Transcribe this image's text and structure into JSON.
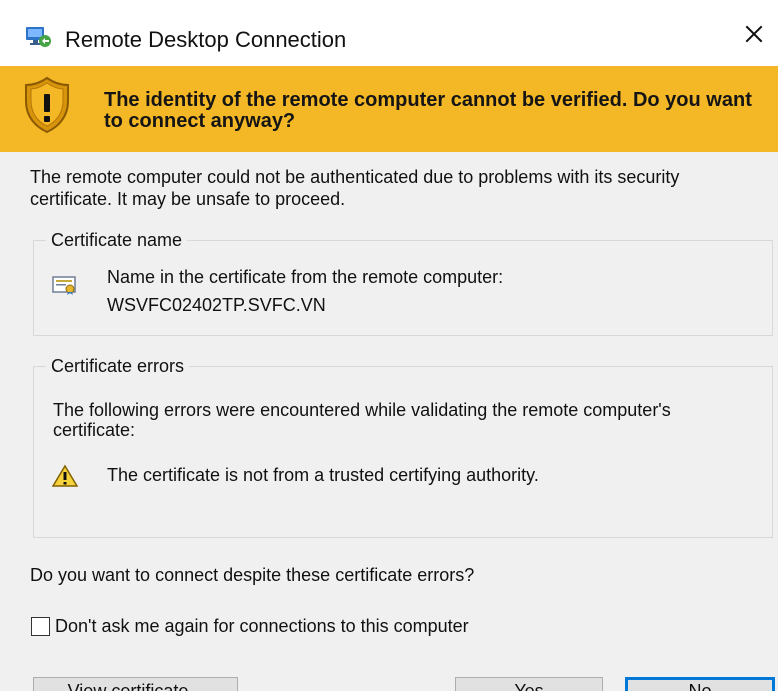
{
  "window": {
    "title": "Remote Desktop Connection",
    "close_icon": "close-icon",
    "app_icon": "remote-desktop-icon"
  },
  "warning_banner": {
    "text": "The identity of the remote computer cannot be verified. Do you want to connect anyway?",
    "icon": "security-warning-shield-icon",
    "background": "#f4b725"
  },
  "intro": {
    "text": "The remote computer could not be authenticated due to problems with its security certificate. It may be unsafe to proceed."
  },
  "certificate_name": {
    "group_title": "Certificate name",
    "icon": "certificate-icon",
    "label": "Name in the certificate from the remote computer:",
    "value": "WSVFC02402TP.SVFC.VN"
  },
  "certificate_errors": {
    "group_title": "Certificate errors",
    "intro": "The following errors were encountered while validating the remote computer's certificate:",
    "warning_icon": "warning-triangle-icon",
    "items": [
      {
        "text": "The certificate is not from a trusted certifying authority."
      }
    ]
  },
  "question": {
    "text": "Do you want to connect despite these certificate errors?"
  },
  "options": {
    "dont_ask_label": "Don't ask me again for connections to this computer",
    "dont_ask_checked": false
  },
  "buttons": {
    "view_certificate": "View certificate...",
    "yes": "Yes",
    "no": "No"
  }
}
